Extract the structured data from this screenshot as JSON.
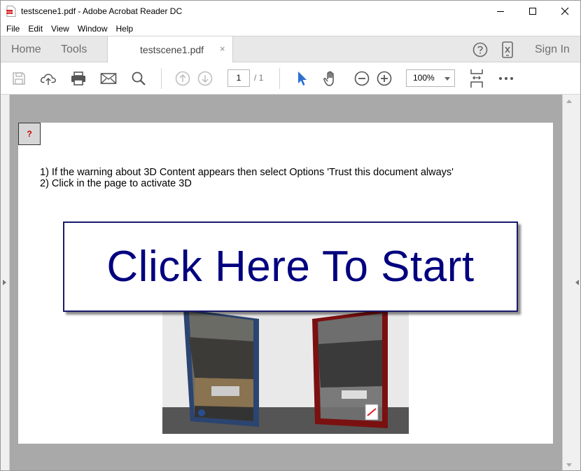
{
  "window": {
    "title": "testscene1.pdf - Adobe Acrobat Reader DC",
    "minimize_icon": "minimize-icon",
    "maximize_icon": "maximize-icon",
    "close_icon": "close-icon"
  },
  "menu": {
    "items": [
      "File",
      "Edit",
      "View",
      "Window",
      "Help"
    ]
  },
  "tabs": {
    "home": "Home",
    "tools": "Tools",
    "document": "testscene1.pdf",
    "document_close": "×",
    "sign_in": "Sign In"
  },
  "toolbar": {
    "page_current": "1",
    "page_total": "/ 1",
    "zoom": "100%",
    "icons": [
      "save-icon",
      "upload-icon",
      "print-icon",
      "email-icon",
      "search-icon",
      "prev-page-icon",
      "next-page-icon",
      "select-cursor-icon",
      "hand-icon",
      "zoom-out-icon",
      "zoom-in-icon",
      "fit-page-icon",
      "more-icon"
    ]
  },
  "document": {
    "help_marker": "?",
    "instruction_1": "1) If the warning about 3D Content appears then select Options 'Trust this document always'",
    "instruction_2": "2) Click in the page to activate 3D",
    "start_button": "Click Here To Start"
  },
  "colors": {
    "start_text": "#00007f",
    "selected_tool": "#2d6fd0",
    "pdf_red": "#d62020"
  }
}
